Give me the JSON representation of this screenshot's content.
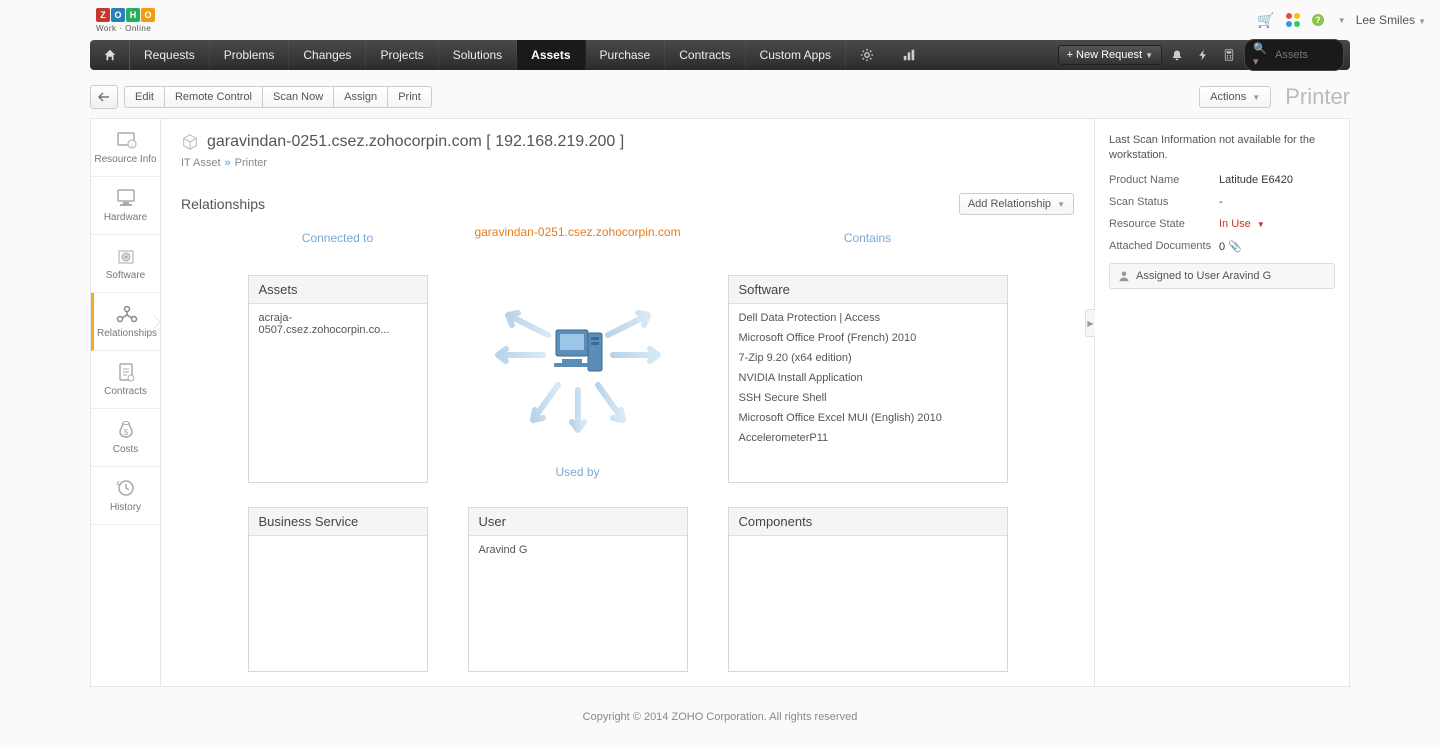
{
  "logo": {
    "letters": [
      "Z",
      "O",
      "H",
      "O"
    ],
    "colors": [
      "#c0392b",
      "#2980b9",
      "#27ae60",
      "#f39c12"
    ],
    "sub": "Work · Online"
  },
  "header": {
    "user": "Lee Smiles"
  },
  "nav": {
    "tabs": [
      "Requests",
      "Problems",
      "Changes",
      "Projects",
      "Solutions",
      "Assets",
      "Purchase",
      "Contracts",
      "Custom Apps"
    ],
    "active": 5,
    "newRequest": "+ New Request",
    "searchPlaceholder": "Assets"
  },
  "toolbar": {
    "buttons": [
      "Edit",
      "Remote Control",
      "Scan Now",
      "Assign",
      "Print"
    ],
    "actions": "Actions",
    "pageType": "Printer"
  },
  "sidebar": {
    "items": [
      {
        "label": "Resource Info"
      },
      {
        "label": "Hardware"
      },
      {
        "label": "Software"
      },
      {
        "label": "Relationships"
      },
      {
        "label": "Contracts"
      },
      {
        "label": "Costs"
      },
      {
        "label": "History"
      }
    ],
    "active": 3
  },
  "asset": {
    "title": "garavindan-0251.csez.zohocorpin.com [ 192.168.219.200 ]",
    "breadcrumb": {
      "a": "IT Asset",
      "b": "Printer"
    }
  },
  "relationships": {
    "heading": "Relationships",
    "addBtn": "Add Relationship",
    "colHeaders": {
      "left": "Connected to",
      "center": "garavindan-0251.csez.zohocorpin.com",
      "right": "Contains",
      "usedby": "Used by"
    },
    "boxes": {
      "assets": {
        "title": "Assets",
        "items": [
          "acraja-0507.csez.zohocorpin.co..."
        ]
      },
      "business": {
        "title": "Business Service",
        "items": []
      },
      "user": {
        "title": "User",
        "items": [
          "Aravind G"
        ]
      },
      "software": {
        "title": "Software",
        "items": [
          "Dell Data Protection | Access",
          "Microsoft Office Proof (French) 2010",
          "7-Zip 9.20 (x64 edition)",
          "NVIDIA Install Application",
          "SSH Secure Shell",
          "Microsoft Office Excel MUI (English) 2010",
          "AccelerometerP11"
        ]
      },
      "components": {
        "title": "Components",
        "items": []
      }
    }
  },
  "rightPanel": {
    "scanInfo": "Last Scan Information not available for the workstation.",
    "props": [
      {
        "label": "Product Name",
        "value": "Latitude E6420"
      },
      {
        "label": "Scan Status",
        "value": "-"
      },
      {
        "label": "Resource State",
        "value": "In Use",
        "inUse": true
      },
      {
        "label": "Attached Documents",
        "value": "0"
      }
    ],
    "assigned": "Assigned to User Aravind G"
  },
  "footer": "Copyright © 2014 ZOHO Corporation. All rights reserved"
}
